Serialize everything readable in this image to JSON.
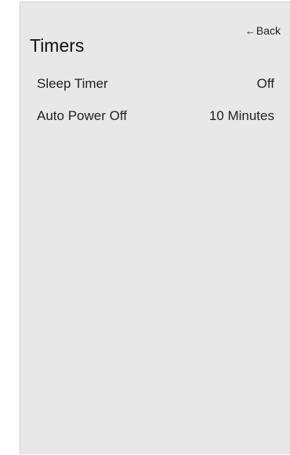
{
  "header": {
    "title": "Timers",
    "back_label": "Back",
    "back_icon": "left-arrow-icon"
  },
  "menu": {
    "items": [
      {
        "label": "Sleep Timer",
        "value": "Off"
      },
      {
        "label": "Auto Power Off",
        "value": "10 Minutes"
      }
    ]
  },
  "colors": {
    "panel_background": "#e8e8e8",
    "page_background": "#ffffff",
    "text": "#222222"
  }
}
